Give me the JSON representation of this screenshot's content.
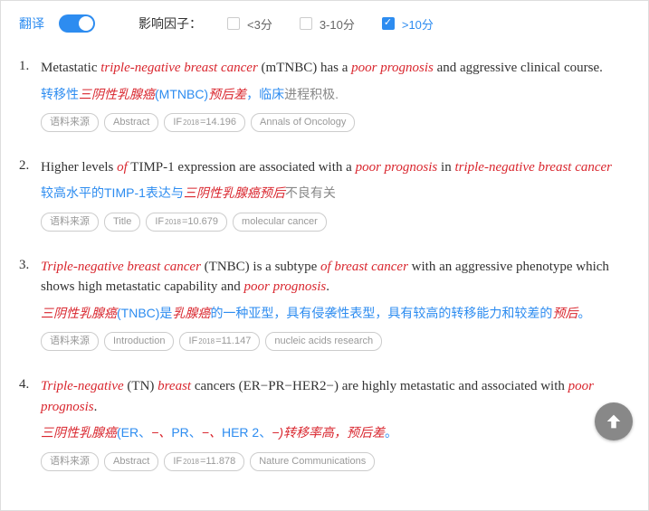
{
  "filters": {
    "translate_label": "翻译",
    "factor_label": "影响因子：",
    "opt1": "<3分",
    "opt2": "3-10分",
    "opt3": ">10分"
  },
  "tags": {
    "source": "语料来源",
    "abstract": "Abstract",
    "title": "Title",
    "introduction": "Introduction",
    "if_prefix": "IF",
    "if_year": "2018",
    "if1": "=14.196",
    "if2": "=10.679",
    "if3": "=11.147",
    "if4": "=11.878",
    "j1": "Annals of Oncology",
    "j2": "molecular cancer",
    "j3": "nucleic acids research",
    "j4": "Nature Communications"
  },
  "r1": {
    "t_a": "Metastatic ",
    "t_b": "triple-negative breast cancer",
    "t_c": " (mTNBC) has a ",
    "t_d": "poor prognosis",
    "t_e": " and aggressive clinical course.",
    "tr_a": "转移性",
    "tr_b": "三阴性乳腺癌",
    "tr_c": "(MTNBC)",
    "tr_d": "预后差",
    "tr_e": "，临床",
    "tr_f": "进程积极."
  },
  "r2": {
    "t_a": "Higher levels ",
    "t_b": "of",
    "t_c": " TIMP-1 expression are associated with a ",
    "t_d": "poor prognosis",
    "t_e": " in ",
    "t_f": "triple-negative breast cancer",
    "tr_a": "较高水平的TIMP-1表达与",
    "tr_b": "三阴性乳腺癌预后",
    "tr_c": "不良有关"
  },
  "r3": {
    "t_a": "Triple-negative breast cancer",
    "t_b": " (TNBC) is a subtype ",
    "t_c": "of breast cancer",
    "t_d": " with an aggressive phenotype which shows high metastatic capability and ",
    "t_e": "poor prognosis",
    "t_f": ".",
    "tr_a": "三阴性乳腺癌",
    "tr_b": "(TNBC)是",
    "tr_c": "乳腺癌",
    "tr_d": "的一种亚型，具有侵袭性表型，具有较高的转移能力和较差的",
    "tr_e": "预后",
    "tr_f": "。"
  },
  "r4": {
    "t_a": "Triple-negative",
    "t_b": " (TN) ",
    "t_c": "breast",
    "t_d": " cancers (ER−PR−HER2−) are highly metastatic and associated with ",
    "t_e": "poor prognosis",
    "t_f": ".",
    "tr_a": "三阴性乳腺癌",
    "tr_b": "(ER、",
    "tr_c": "−、",
    "tr_d": "PR、",
    "tr_e": "−、",
    "tr_f": "HER 2、",
    "tr_g": "−)转移率高，",
    "tr_h": "预后差",
    "tr_i": "。"
  }
}
